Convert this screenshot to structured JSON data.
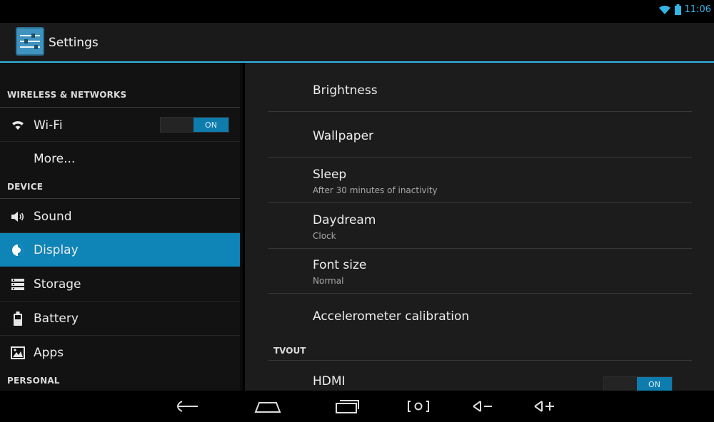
{
  "status": {
    "time": "11:06",
    "icons": [
      "wifi-icon",
      "battery-icon"
    ]
  },
  "actionbar": {
    "title": "Settings",
    "icon": "settings-icon"
  },
  "sidebar": {
    "wireless_header": "WIRELESS & NETWORKS",
    "device_header": "DEVICE",
    "personal_header": "PERSONAL",
    "items": [
      {
        "label": "Wi-Fi",
        "icon": "wifi-icon",
        "toggle": "ON"
      },
      {
        "label": "More..."
      },
      {
        "label": "Sound",
        "icon": "speaker-icon"
      },
      {
        "label": "Display",
        "icon": "display-icon",
        "selected": true
      },
      {
        "label": "Storage",
        "icon": "storage-icon"
      },
      {
        "label": "Battery",
        "icon": "battery-icon"
      },
      {
        "label": "Apps",
        "icon": "apps-icon"
      }
    ]
  },
  "content": {
    "prefs": [
      {
        "title": "Brightness",
        "summary": ""
      },
      {
        "title": "Wallpaper",
        "summary": ""
      },
      {
        "title": "Sleep",
        "summary": "After 30 minutes of inactivity"
      },
      {
        "title": "Daydream",
        "summary": "Clock"
      },
      {
        "title": "Font size",
        "summary": "Normal"
      },
      {
        "title": "Accelerometer calibration",
        "summary": ""
      }
    ],
    "tvout_header": "TVOUT",
    "hdmi": {
      "title": "HDMI",
      "toggle": "ON"
    }
  },
  "navbar": {
    "buttons": [
      "back-icon",
      "home-icon",
      "recents-icon",
      "screenshot-icon",
      "volume-down-icon",
      "volume-up-icon"
    ]
  },
  "colors": {
    "accent": "#33b5e5",
    "selected": "#0f84b6"
  }
}
